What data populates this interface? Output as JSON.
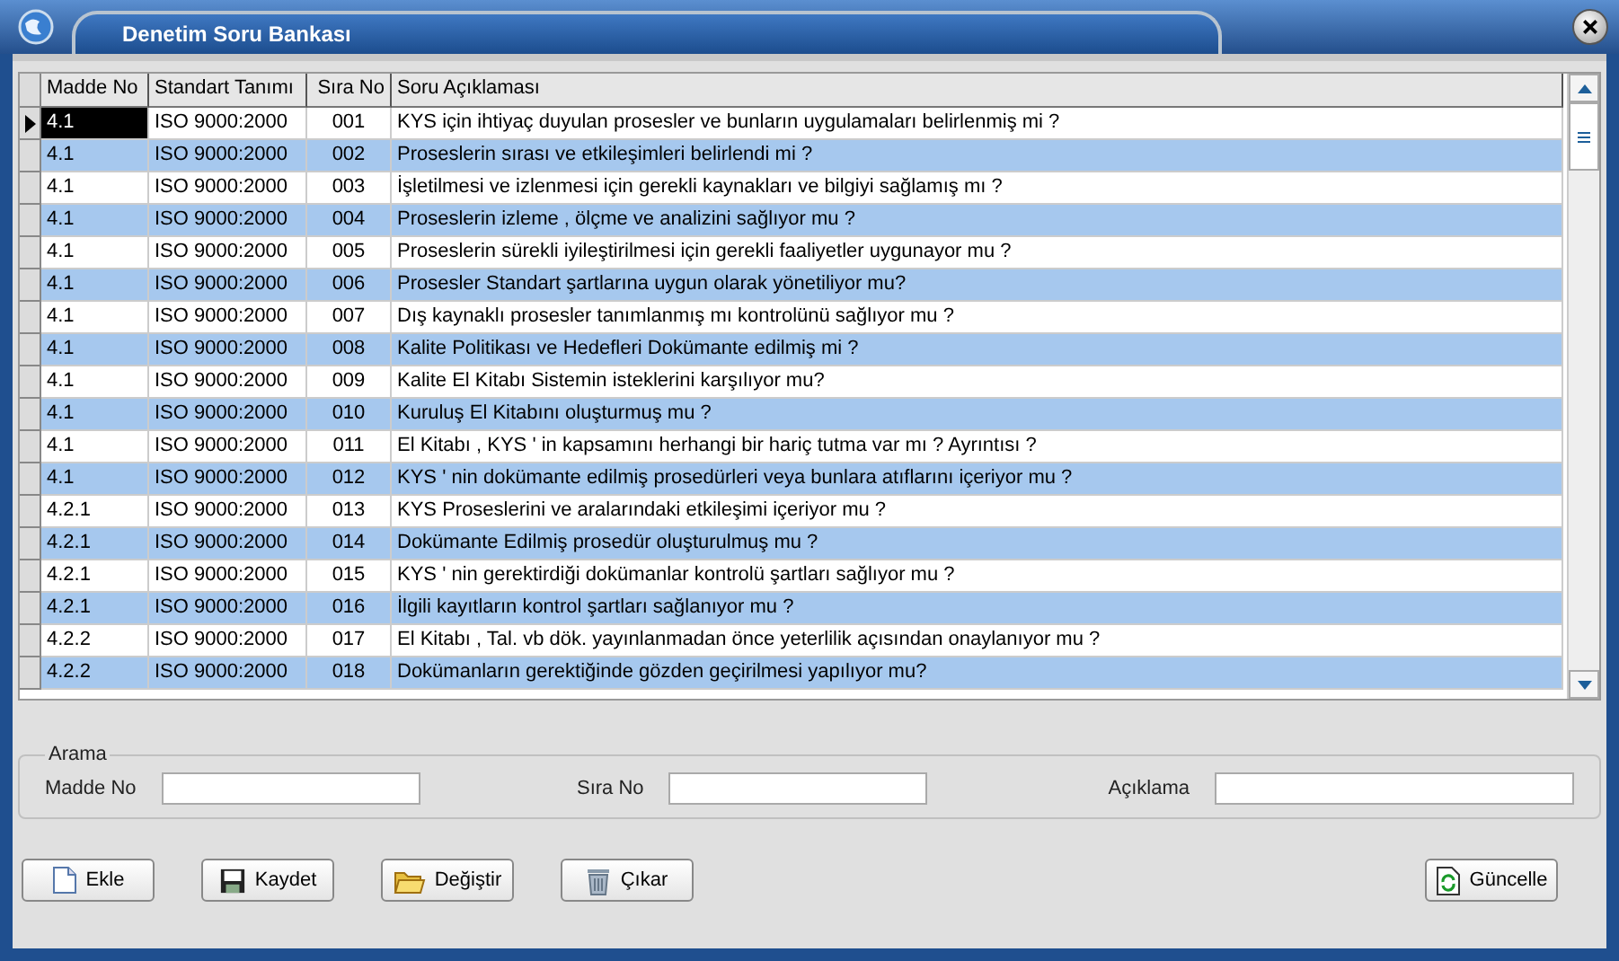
{
  "window": {
    "title": "Denetim Soru Bankası"
  },
  "table": {
    "columns": [
      "Madde No",
      "Standart Tanımı",
      "Sıra No",
      "Soru Açıklaması"
    ],
    "rows": [
      {
        "cells": [
          "4.1",
          "ISO 9000:2000",
          "001",
          "KYS için ihtiyaç duyulan prosesler ve bunların uygulamaları belirlenmiş mi ?"
        ],
        "selected": true
      },
      {
        "cells": [
          "4.1",
          "ISO 9000:2000",
          "002",
          "Proseslerin sırası ve etkileşimleri belirlendi mi ?"
        ],
        "selected": false
      },
      {
        "cells": [
          "4.1",
          "ISO 9000:2000",
          "003",
          "İşletilmesi ve izlenmesi için gerekli kaynakları ve bilgiyi sağlamış mı ?"
        ],
        "selected": false
      },
      {
        "cells": [
          "4.1",
          "ISO 9000:2000",
          "004",
          "Proseslerin izleme , ölçme ve analizini sağlıyor mu ?"
        ],
        "selected": false
      },
      {
        "cells": [
          "4.1",
          "ISO 9000:2000",
          "005",
          "Proseslerin sürekli iyileştirilmesi için gerekli faaliyetler uygunayor mu ?"
        ],
        "selected": false
      },
      {
        "cells": [
          "4.1",
          "ISO 9000:2000",
          "006",
          "Prosesler Standart şartlarına uygun olarak yönetiliyor mu?"
        ],
        "selected": false
      },
      {
        "cells": [
          "4.1",
          "ISO 9000:2000",
          "007",
          "Dış kaynaklı prosesler tanımlanmış mı kontrolünü sağlıyor mu ?"
        ],
        "selected": false
      },
      {
        "cells": [
          "4.1",
          "ISO 9000:2000",
          "008",
          "Kalite Politikası ve Hedefleri Dokümante edilmiş mi ?"
        ],
        "selected": false
      },
      {
        "cells": [
          "4.1",
          "ISO 9000:2000",
          "009",
          "Kalite El Kitabı Sistemin isteklerini karşılıyor mu?"
        ],
        "selected": false
      },
      {
        "cells": [
          "4.1",
          "ISO 9000:2000",
          "010",
          "Kuruluş El Kitabını oluşturmuş  mu ?"
        ],
        "selected": false
      },
      {
        "cells": [
          "4.1",
          "ISO 9000:2000",
          "011",
          "El Kitabı , KYS ' in kapsamını herhangi bir hariç tutma var mı ? Ayrıntısı ?"
        ],
        "selected": false
      },
      {
        "cells": [
          "4.1",
          "ISO 9000:2000",
          "012",
          "KYS ' nin dokümante edilmiş prosedürleri veya bunlara atıflarını içeriyor mu ?"
        ],
        "selected": false
      },
      {
        "cells": [
          "4.2.1",
          "ISO 9000:2000",
          "013",
          "KYS Proseslerini ve aralarındaki etkileşimi içeriyor mu ?"
        ],
        "selected": false
      },
      {
        "cells": [
          "4.2.1",
          "ISO 9000:2000",
          "014",
          "Dokümante Edilmiş prosedür oluşturulmuş mu ?"
        ],
        "selected": false
      },
      {
        "cells": [
          "4.2.1",
          "ISO 9000:2000",
          "015",
          "KYS ' nin gerektirdiği dokümanlar kontrolü şartları sağlıyor mu ?"
        ],
        "selected": false
      },
      {
        "cells": [
          "4.2.1",
          "ISO 9000:2000",
          "016",
          "İlgili kayıtların kontrol şartları sağlanıyor mu ?"
        ],
        "selected": false
      },
      {
        "cells": [
          "4.2.2",
          "ISO 9000:2000",
          "017",
          "El Kitabı , Tal. vb dök. yayınlanmadan önce yeterlilik açısından onaylanıyor mu ?"
        ],
        "selected": false
      },
      {
        "cells": [
          "4.2.2",
          "ISO 9000:2000",
          "018",
          "Dokümanların gerektiğinde gözden geçirilmesi yapılıyor mu?"
        ],
        "selected": false
      }
    ]
  },
  "search": {
    "title": "Arama",
    "fields": [
      {
        "label": "Madde No"
      },
      {
        "label": "Sıra No"
      },
      {
        "label": "Açıklama"
      }
    ]
  },
  "buttons": [
    {
      "label": "Ekle",
      "kind": "new"
    },
    {
      "label": "Kaydet",
      "kind": "save"
    },
    {
      "label": "Değiştir",
      "kind": "edit"
    },
    {
      "label": "Çıkar",
      "kind": "delete"
    },
    {
      "label": "Güncelle",
      "kind": "refresh"
    }
  ]
}
